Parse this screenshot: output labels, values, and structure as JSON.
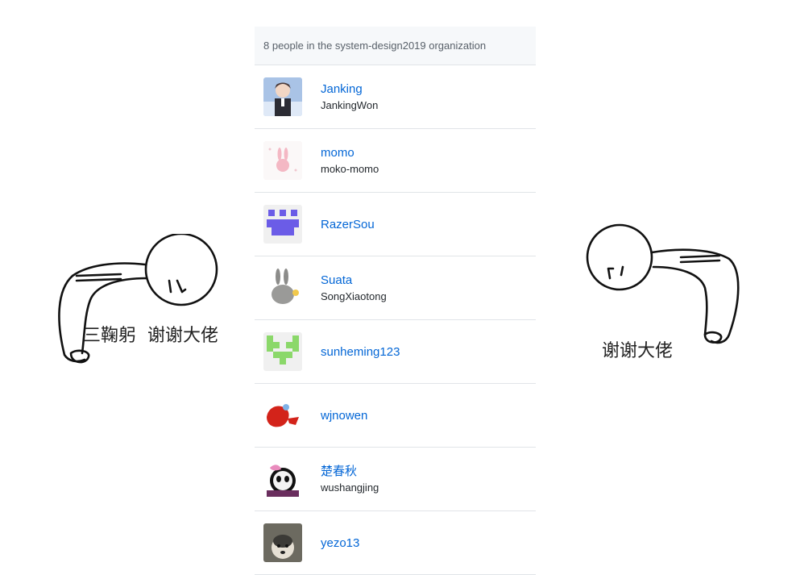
{
  "panel": {
    "header": "8 people in the system-design2019 organization"
  },
  "members": [
    {
      "display_name": "Janking",
      "login": "JankingWon"
    },
    {
      "display_name": "momo",
      "login": "moko-momo"
    },
    {
      "display_name": "RazerSou",
      "login": ""
    },
    {
      "display_name": "Suata",
      "login": "SongXiaotong"
    },
    {
      "display_name": "sunheming123",
      "login": ""
    },
    {
      "display_name": "wjnowen",
      "login": ""
    },
    {
      "display_name": "楚春秋",
      "login": "wushangjing"
    },
    {
      "display_name": "yezo13",
      "login": ""
    }
  ],
  "left_sticker": {
    "caption": "三鞠躬  谢谢大佬"
  },
  "right_sticker": {
    "caption": "谢谢大佬"
  },
  "colors": {
    "link": "#0366d6",
    "header_bg": "#f6f8fa",
    "border": "#e1e4e8"
  }
}
